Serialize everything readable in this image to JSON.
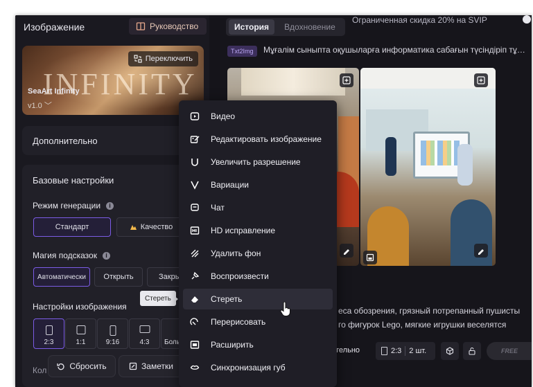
{
  "left_panel": {
    "title": "Изображение",
    "guide_label": "Руководство",
    "model": {
      "switch_label": "Переключить",
      "banner_text": "INFINITY",
      "name": "SeaArt Infinity",
      "version": "v1.0"
    },
    "advanced_label": "Дополнительно",
    "basic_settings_label": "Базовые настройки",
    "generation_mode": {
      "label": "Режим генерации",
      "options": [
        "Стандарт",
        "Качество"
      ],
      "selected": "Стандарт"
    },
    "prompt_magic": {
      "label": "Магия подсказок",
      "options": [
        "Автоматически",
        "Открыть",
        "Закры"
      ],
      "selected": "Автоматически"
    },
    "image_settings": {
      "label": "Настройки изображения",
      "ratios": [
        "2:3",
        "1:1",
        "9:16",
        "4:3",
        "Боль"
      ],
      "selected": "2:3"
    },
    "tooltip": "Стереть",
    "footer_partial": "Кол",
    "reset_label": "Сбросить",
    "notes_label": "Заметки"
  },
  "right_panel": {
    "tabs": [
      "История",
      "Вдохновение"
    ],
    "active_tab": "История",
    "promo_banner": "Ограниченная скидка 20% на SVIP",
    "task_badge": "Txt2Img",
    "task_prompt": "Мұғалім сыныпта оқушыларға информатика сабағын түсіндіріп тұр...",
    "prompt_text_line1": "еса обозрения, грязный потрепанный пушисты",
    "prompt_text_line2": "го фигурок Lego, мягкие игрушки веселятся",
    "bottom_bar": {
      "advanced_partial": "тельно",
      "ratio": "2:3",
      "count": "2 шт.",
      "free_label": "FREE"
    }
  },
  "context_menu": {
    "items": [
      {
        "label": "Видео",
        "icon": "video-icon"
      },
      {
        "label": "Редактировать изображение",
        "icon": "edit-image-icon"
      },
      {
        "label": "Увеличить разрешение",
        "icon": "upscale-icon"
      },
      {
        "label": "Вариации",
        "icon": "variations-icon"
      },
      {
        "label": "Чат",
        "icon": "chat-icon"
      },
      {
        "label": "HD исправление",
        "icon": "hd-fix-icon"
      },
      {
        "label": "Удалить фон",
        "icon": "remove-bg-icon"
      },
      {
        "label": "Воспроизвести",
        "icon": "reproduce-icon"
      },
      {
        "label": "Стереть",
        "icon": "eraser-icon"
      },
      {
        "label": "Перерисовать",
        "icon": "redraw-icon"
      },
      {
        "label": "Расширить",
        "icon": "expand-icon"
      },
      {
        "label": "Синхронизация губ",
        "icon": "lip-sync-icon"
      }
    ],
    "highlighted": "Стереть"
  },
  "colors": {
    "accent": "#7c5ce6",
    "panel_bg": "#1a1920",
    "card_bg": "#212028",
    "menu_bg": "#1f1e26"
  }
}
